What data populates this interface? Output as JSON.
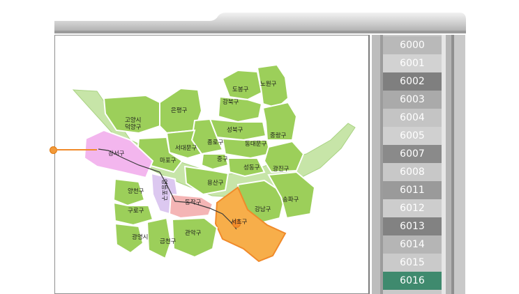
{
  "routes": [
    {
      "label": "6000",
      "color": "#b9b9b9"
    },
    {
      "label": "6001",
      "color": "#d2d2d2"
    },
    {
      "label": "6002",
      "color": "#7f7f7f"
    },
    {
      "label": "6003",
      "color": "#aaaaaa"
    },
    {
      "label": "6004",
      "color": "#c4c4c4"
    },
    {
      "label": "6005",
      "color": "#d0d0d0"
    },
    {
      "label": "6007",
      "color": "#8a8a8a"
    },
    {
      "label": "6008",
      "color": "#c8c8c8"
    },
    {
      "label": "6011",
      "color": "#9a9a9a"
    },
    {
      "label": "6012",
      "color": "#cdcdcd"
    },
    {
      "label": "6013",
      "color": "#828282"
    },
    {
      "label": "6014",
      "color": "#b5b5b5"
    },
    {
      "label": "6015",
      "color": "#cacaca"
    },
    {
      "label": "6016",
      "color": "#3f8a6e"
    }
  ],
  "map": {
    "regions": {
      "nowon": "노원구",
      "dobong": "도봉구",
      "gangbuk": "강북구",
      "eunpyeong": "은평구",
      "goyang": "고양시\n덕양구",
      "seongbuk": "성북구",
      "jungnang": "중랑구",
      "jongno": "종로구",
      "seodaemun": "서대문구",
      "dongdaemun": "동대문구",
      "mapo": "마포구",
      "junggu": "중구",
      "seongdong": "성동구",
      "gwangjin": "광진구",
      "gangseo": "강서구",
      "yongsan": "용산구",
      "yangcheon": "양천구",
      "yeongdeungpo": "영등포구",
      "dongjak": "동작구",
      "songpa": "송파구",
      "gangnam": "강남구",
      "guro": "구로구",
      "seocho": "서초구",
      "gwanak": "관악구",
      "gwangmyeong": "광명시",
      "geumcheon": "금천구"
    },
    "colors": {
      "district": "#9ccf5a",
      "river": "#c7e5a8",
      "highlight_pink": "#f3b6ee",
      "highlight_orange": "#f7ae4a",
      "route_line": "#f08a2a"
    }
  }
}
